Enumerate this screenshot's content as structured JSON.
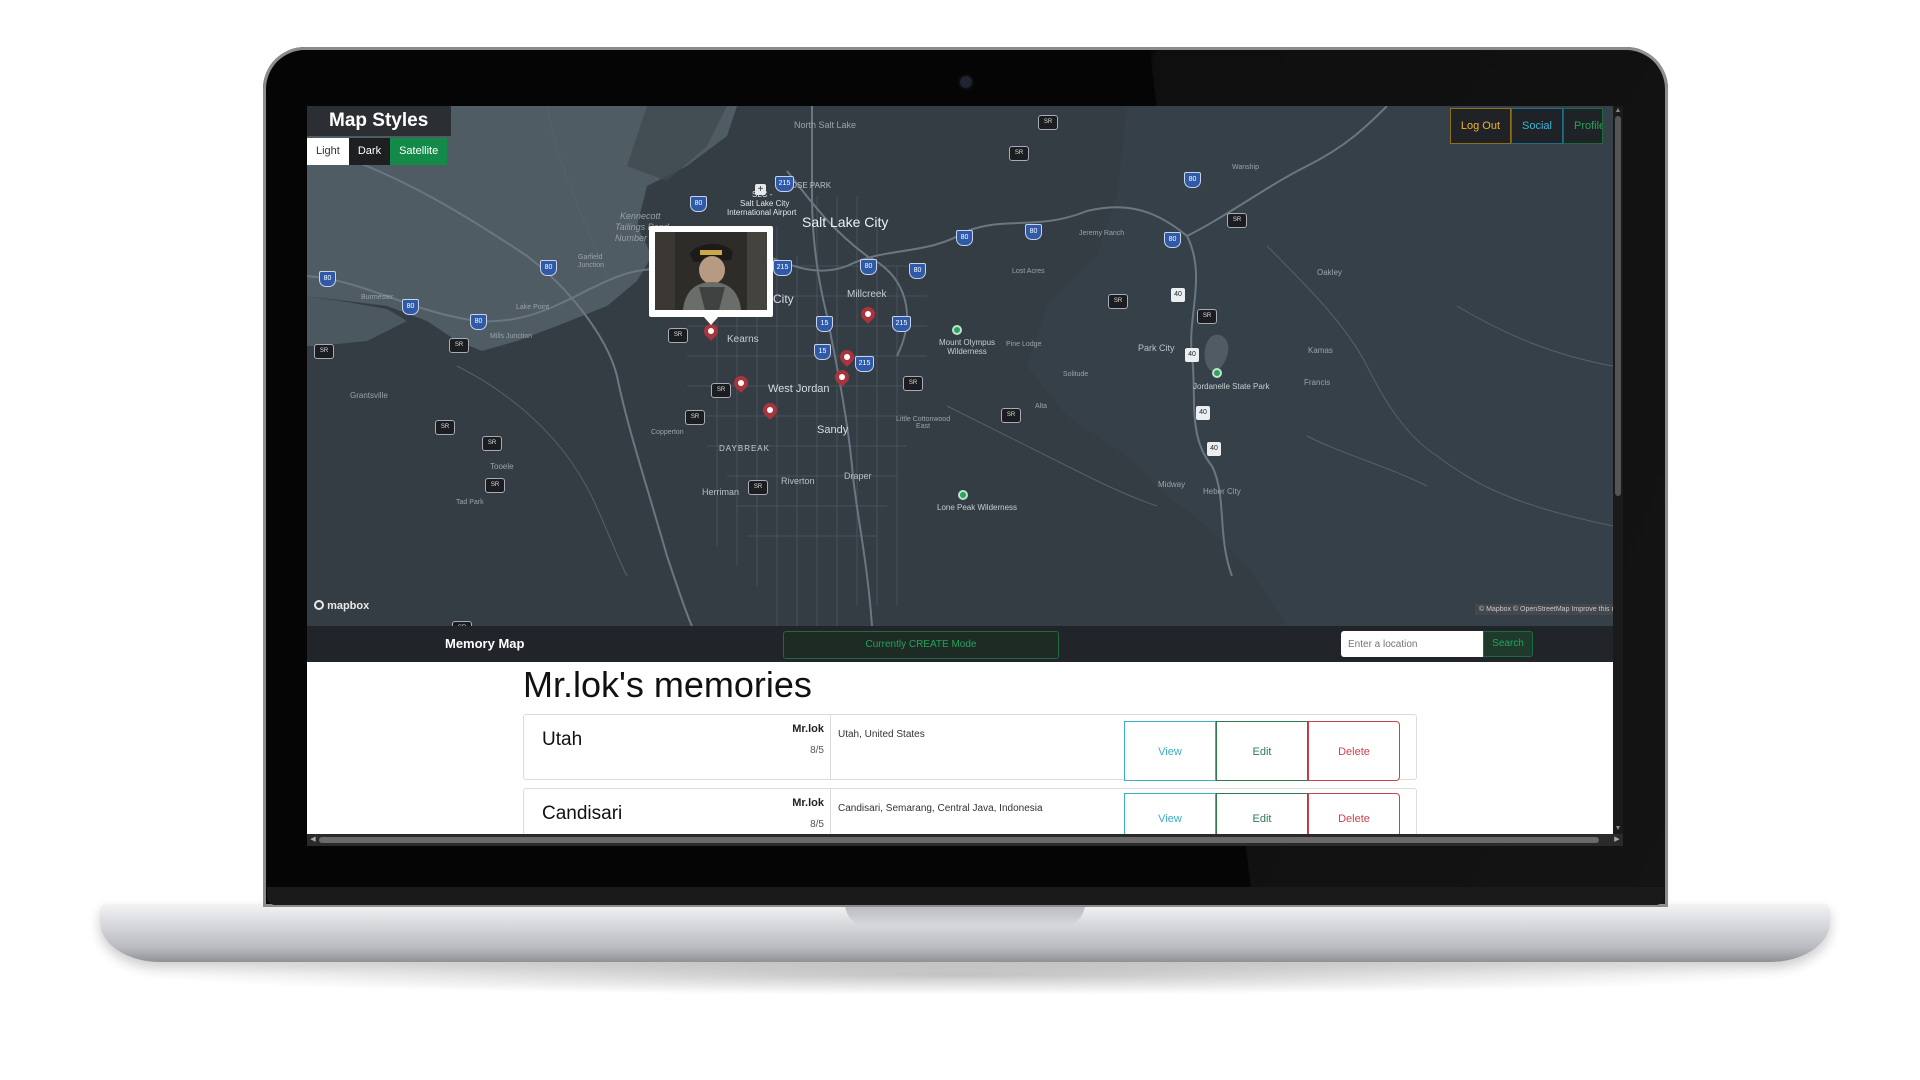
{
  "map_styles": {
    "title": "Map Styles",
    "options": [
      "Light",
      "Dark",
      "Satellite"
    ],
    "selected": "Satellite"
  },
  "top_nav": {
    "logout": "Log Out",
    "social": "Social",
    "profile": "Profile"
  },
  "map": {
    "labels": {
      "north_salt_lake": "North Salt Lake",
      "rose_park": "ROSE PARK",
      "slc": "SLC -",
      "airport_1": "Salt Lake City",
      "airport_2": "International Airport",
      "salt_lake_city": "Salt Lake City",
      "kennecott_1": "Kennecott",
      "kennecott_2": "Tailings Pond",
      "kennecott_3": "Number 1",
      "city": "City",
      "millcreek": "Millcreek",
      "kearns": "Kearns",
      "west_jordan": "West Jordan",
      "sandy": "Sandy",
      "daybreak": "DAYBREAK",
      "riverton": "Riverton",
      "draper": "Draper",
      "herriman": "Herriman",
      "copperton": "Copperton",
      "lake_point": "Lake Point",
      "mills_junction": "Mills Junction",
      "grantsville": "Grantsville",
      "tooele": "Tooele",
      "tad_park": "Tad Park",
      "garfield_1": "Garfield",
      "garfield_2": "Junction",
      "burmester": "Burmester",
      "mount_olympus_1": "Mount Olympus",
      "mount_olympus_2": "Wilderness",
      "pine_lodge": "Pine Lodge",
      "lost_acres": "Lost Acres",
      "solitude": "Solitude",
      "alta": "Alta",
      "little_cottonwood_1": "Little Cottonwood",
      "little_cottonwood_2": "East",
      "lone_peak": "Lone Peak Wilderness",
      "park_city": "Park City",
      "jordanelle": "Jordanelle State Park",
      "kamas": "Kamas",
      "francis": "Francis",
      "oakley": "Oakley",
      "wanship": "Wanship",
      "jeremy_ranch": "Jeremy Ranch",
      "midway": "Midway",
      "heber_city": "Heber City"
    },
    "shields": {
      "i80": "80",
      "i215": "215",
      "i15": "15",
      "us40": "40",
      "sr": "SR"
    },
    "logo": "mapbox",
    "attribution": "© Mapbox © OpenStreetMap Improve this map"
  },
  "app_bar": {
    "brand": "Memory Map",
    "mode": "Currently CREATE Mode",
    "search_placeholder": "Enter a location",
    "search_button": "Search"
  },
  "memories": {
    "title": "Mr.lok's memories",
    "items": [
      {
        "name": "Utah",
        "owner": "Mr.lok",
        "date": "8/5",
        "address": "Utah, United States",
        "view": "View",
        "edit": "Edit",
        "delete": "Delete"
      },
      {
        "name": "Candisari",
        "owner": "Mr.lok",
        "date": "8/5",
        "address": "Candisari, Semarang, Central Java, Indonesia",
        "view": "View",
        "edit": "Edit",
        "delete": "Delete"
      }
    ]
  },
  "colors": {
    "map_land": "#343c44",
    "water": "#4f5c64",
    "road": "#5d6872",
    "marker": "#b03a3a",
    "accent_green": "#138a47"
  }
}
